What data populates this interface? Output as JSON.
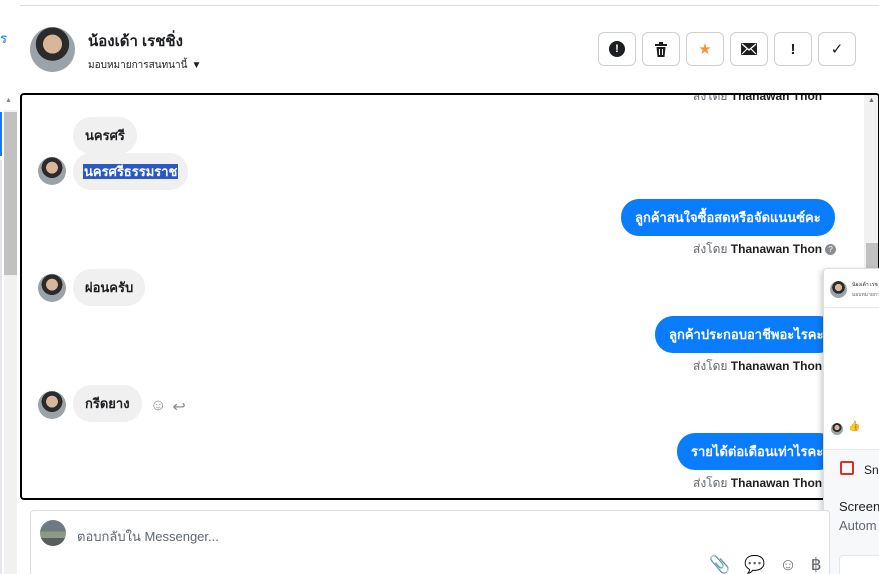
{
  "header": {
    "contact_name": "น้องเด้า เรชชิ่ง",
    "assign_label": "มอบหมายการสนทนานี้",
    "actions": [
      {
        "name": "mark-spam",
        "icon": "exclamation-circle-icon"
      },
      {
        "name": "delete",
        "icon": "trash-icon"
      },
      {
        "name": "star",
        "icon": "star-icon"
      },
      {
        "name": "mark-unread",
        "icon": "envelope-icon"
      },
      {
        "name": "follow-up",
        "icon": "exclamation-icon"
      },
      {
        "name": "mark-done",
        "icon": "checkmark-icon"
      }
    ],
    "colors": {
      "star": "#f7923b"
    }
  },
  "conversation": {
    "top_partial_sender": "Thanawan Thon",
    "sent_by_prefix": "ส่งโดย",
    "messages": [
      {
        "direction": "in",
        "text": "นครศรี"
      },
      {
        "direction": "in",
        "text": "นครศรีธรรมราช",
        "selected": true
      },
      {
        "direction": "out",
        "text": "ลูกค้าสนใจซื้อสดหรือจัดแนนซ์คะ",
        "sender": "Thanawan Thon"
      },
      {
        "direction": "in",
        "text": "ผ่อนครับ"
      },
      {
        "direction": "out",
        "text": "ลูกค้าประกอบอาชีพอะไรคะ",
        "sender": "Thanawan Thon"
      },
      {
        "direction": "in",
        "text": "กรีดยาง"
      },
      {
        "direction": "out",
        "text": "รายได้ต่อเดือนเท่าไรคะ",
        "sender": "Thanawan Thon"
      }
    ],
    "colors": {
      "outgoing": "#0a7cff",
      "incoming": "#f0f0f0"
    }
  },
  "preview_card": {
    "name": "น้องเด้า เรช",
    "subtitle": "มอบหมายการ",
    "app_label": "Sni",
    "line1": "Screen",
    "line2": "Autom"
  },
  "composer": {
    "placeholder": "ตอบกลับใน Messenger...",
    "tools": [
      "paperclip-icon",
      "saved-reply-icon",
      "emoji-icon",
      "baht-icon"
    ]
  }
}
